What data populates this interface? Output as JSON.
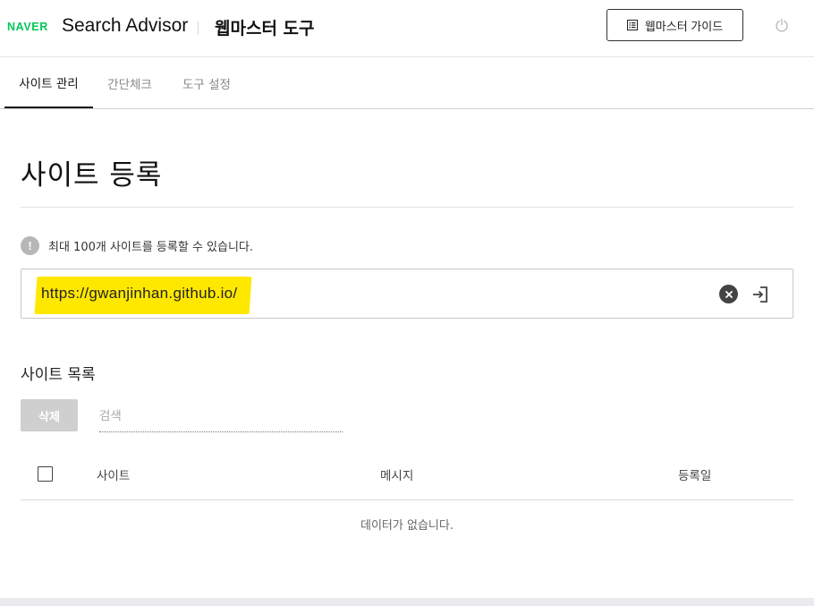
{
  "header": {
    "naver_logo": "NAVER",
    "app_name": "Search Advisor",
    "tool_name": "웹마스터 도구",
    "guide_button_label": "웹마스터 가이드"
  },
  "tabs": [
    {
      "label": "사이트 관리",
      "active": true
    },
    {
      "label": "간단체크",
      "active": false
    },
    {
      "label": "도구 설정",
      "active": false
    }
  ],
  "main": {
    "page_title": "사이트 등록",
    "notice_icon_glyph": "!",
    "notice_text": "최대 100개 사이트를 등록할 수 있습니다.",
    "url_value": "https://gwanjinhan.github.io/",
    "highlight_color": "#ffe800"
  },
  "site_list": {
    "section_title": "사이트 목록",
    "delete_label": "삭제",
    "search_placeholder": "검색",
    "columns": [
      "사이트",
      "메시지",
      "등록일"
    ],
    "empty_message": "데이터가 없습니다."
  },
  "colors": {
    "brand_green": "#03c75a"
  }
}
